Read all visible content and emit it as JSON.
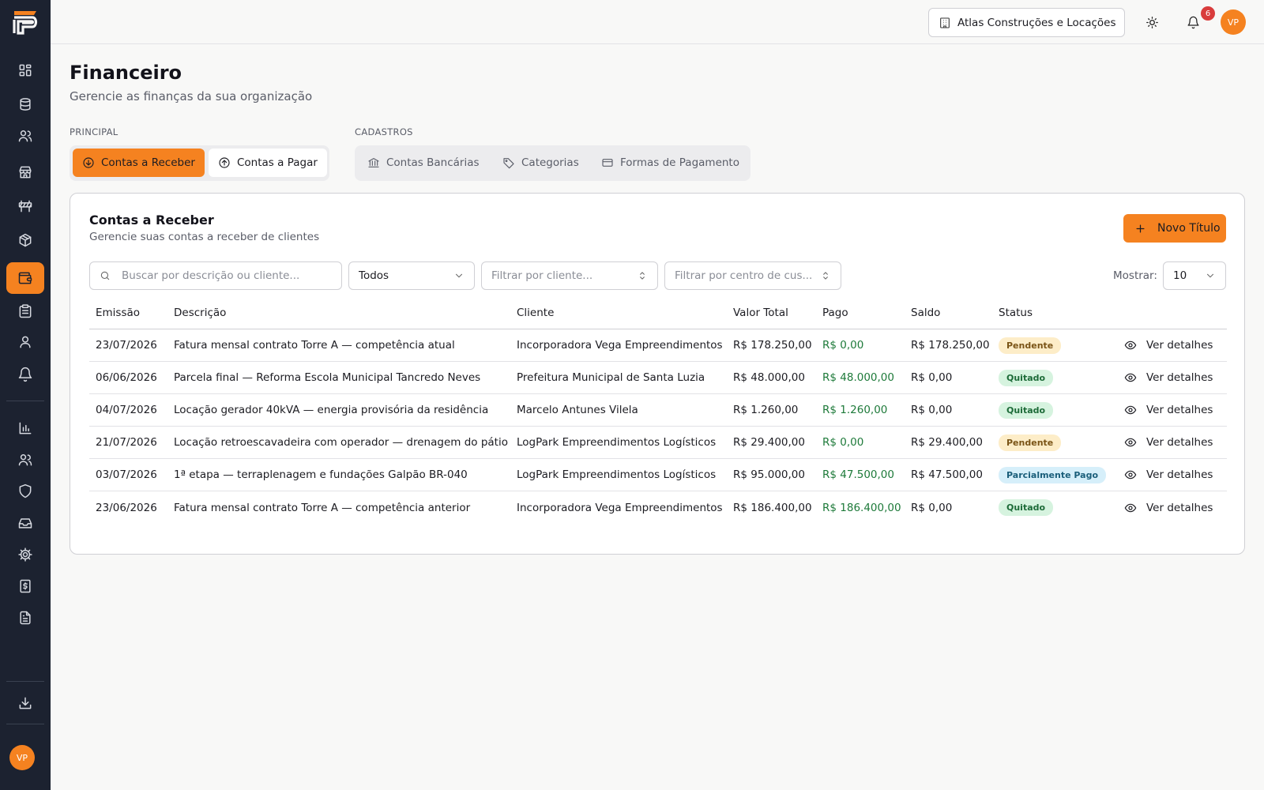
{
  "sidebar": {
    "nav": [
      {
        "icon": "dashboard-icon"
      },
      {
        "icon": "database-icon"
      },
      {
        "icon": "users-icon"
      },
      {
        "icon": "store-icon"
      },
      {
        "icon": "barrier-icon"
      },
      {
        "icon": "box-icon"
      },
      {
        "icon": "wallet-icon",
        "active": true
      },
      {
        "icon": "clipboard-icon"
      },
      {
        "icon": "user-icon"
      },
      {
        "icon": "bell-icon"
      },
      {
        "icon": "bar-chart-icon"
      },
      {
        "icon": "users-group-icon"
      },
      {
        "icon": "shield-icon"
      },
      {
        "icon": "inbox-icon"
      },
      {
        "icon": "settings-icon"
      },
      {
        "icon": "receipt-icon"
      },
      {
        "icon": "document-icon"
      }
    ],
    "download_icon": "download-icon",
    "avatar_initials": "VP"
  },
  "header": {
    "organization": "Atlas Construções e Locações",
    "theme_icon": "sun-icon",
    "notification_count": "6",
    "avatar_initials": "VP"
  },
  "page": {
    "title": "Financeiro",
    "subtitle": "Gerencie as finanças da sua organização"
  },
  "tabs": {
    "principal_label": "PRINCIPAL",
    "cadastros_label": "CADASTROS",
    "principal": [
      {
        "label": "Contas a Receber",
        "icon": "arrow-down-circle-icon",
        "active": true
      },
      {
        "label": "Contas a Pagar",
        "icon": "arrow-up-circle-icon"
      }
    ],
    "cadastros": [
      {
        "label": "Contas Bancárias",
        "icon": "bank-icon"
      },
      {
        "label": "Categorias",
        "icon": "tag-icon"
      },
      {
        "label": "Formas de Pagamento",
        "icon": "credit-card-icon"
      }
    ]
  },
  "card": {
    "title": "Contas a Receber",
    "subtitle": "Gerencie suas contas a receber de clientes",
    "new_button": "Novo Título"
  },
  "filters": {
    "search_placeholder": "Buscar por descrição ou cliente...",
    "status_value": "Todos",
    "client_placeholder": "Filtrar por cliente...",
    "cost_center_placeholder": "Filtrar por centro de cus...",
    "show_label": "Mostrar:",
    "page_size": "10"
  },
  "table": {
    "columns": [
      "Emissão",
      "Descrição",
      "Cliente",
      "Valor Total",
      "Pago",
      "Saldo",
      "Status"
    ],
    "details_label": "Ver detalhes",
    "rows": [
      {
        "emissao": "23/07/2026",
        "descricao": "Fatura mensal contrato Torre A — competência atual",
        "cliente": "Incorporadora Vega Empreendimentos",
        "valor_total": "R$ 178.250,00",
        "pago": "R$ 0,00",
        "saldo": "R$ 178.250,00",
        "status": "Pendente",
        "status_color": "#fdedc8"
      },
      {
        "emissao": "06/06/2026",
        "descricao": "Parcela final — Reforma Escola Municipal Tancredo Neves",
        "cliente": "Prefeitura Municipal de Santa Luzia",
        "valor_total": "R$ 48.000,00",
        "pago": "R$ 48.000,00",
        "saldo": "R$ 0,00",
        "status": "Quitado",
        "status_color": "#d6f3df"
      },
      {
        "emissao": "04/07/2026",
        "descricao": "Locação gerador 40kVA — energia provisória da residência",
        "cliente": "Marcelo Antunes Vilela",
        "valor_total": "R$ 1.260,00",
        "pago": "R$ 1.260,00",
        "saldo": "R$ 0,00",
        "status": "Quitado",
        "status_color": "#d6f3df"
      },
      {
        "emissao": "21/07/2026",
        "descricao": "Locação retroescavadeira com operador — drenagem do pátio",
        "cliente": "LogPark Empreendimentos Logísticos",
        "valor_total": "R$ 29.400,00",
        "pago": "R$ 0,00",
        "saldo": "R$ 29.400,00",
        "status": "Pendente",
        "status_color": "#fdedc8"
      },
      {
        "emissao": "03/07/2026",
        "descricao": "1ª etapa — terraplenagem e fundações Galpão BR-040",
        "cliente": "LogPark Empreendimentos Logísticos",
        "valor_total": "R$ 95.000,00",
        "pago": "R$ 47.500,00",
        "saldo": "R$ 47.500,00",
        "status": "Parcialmente Pago",
        "status_color": "#d6effa"
      },
      {
        "emissao": "23/06/2026",
        "descricao": "Fatura mensal contrato Torre A — competência anterior",
        "cliente": "Incorporadora Vega Empreendimentos",
        "valor_total": "R$ 186.400,00",
        "pago": "R$ 186.400,00",
        "saldo": "R$ 0,00",
        "status": "Quitado",
        "status_color": "#d6f3df"
      }
    ]
  },
  "colors": {
    "accent": "#f58220",
    "sidebar_bg": "#1c2230",
    "paid_text": "#1e7a3a"
  }
}
